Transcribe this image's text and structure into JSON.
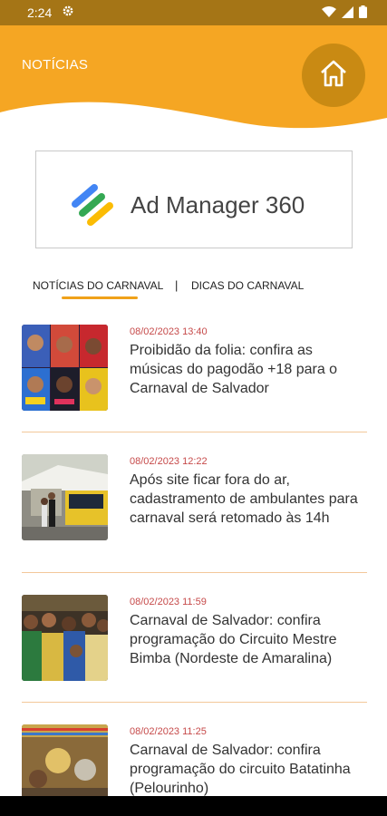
{
  "status": {
    "time": "2:24"
  },
  "header": {
    "title": "NOTÍCIAS",
    "accent": "#f5a623"
  },
  "ad": {
    "label": "Ad Manager 360"
  },
  "tabs": {
    "active": "NOTÍCIAS DO CARNAVAL",
    "separator": "|",
    "other": "DICAS DO CARNAVAL"
  },
  "news": [
    {
      "date": "08/02/2023 13:40",
      "title": "Proibidão da folia: confira as músicas do pagodão +18 para o Carnaval de Salvador"
    },
    {
      "date": "08/02/2023 12:22",
      "title": "Após site ficar fora do ar, cadastramento de ambulantes para carnaval será retomado às 14h"
    },
    {
      "date": "08/02/2023 11:59",
      "title": "Carnaval de Salvador: confira programação do Circuito Mestre Bimba (Nordeste de Amaralina)"
    },
    {
      "date": "08/02/2023 11:25",
      "title": "Carnaval de Salvador: confira programação do circuito Batatinha (Pelourinho)"
    }
  ]
}
